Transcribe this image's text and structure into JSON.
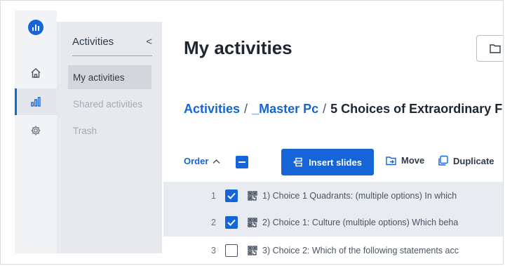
{
  "nav": {
    "section_title": "Activities",
    "collapse_glyph": "<",
    "items": [
      {
        "label": "My activities",
        "active": true
      },
      {
        "label": "Shared activities",
        "active": false
      },
      {
        "label": "Trash",
        "active": false
      }
    ]
  },
  "rail": {
    "icons": [
      "logo-icon",
      "home-icon",
      "activities-chart-icon",
      "settings-gear-icon"
    ]
  },
  "header": {
    "title": "My activities"
  },
  "breadcrumb": {
    "root": "Activities",
    "sep1": "/",
    "folder": "_Master Pc",
    "sep2": "/",
    "current": "5 Choices of Extraordinary F"
  },
  "toolbar": {
    "order_label": "Order",
    "insert_label": "Insert slides",
    "move_label": "Move",
    "duplicate_label": "Duplicate"
  },
  "rows": [
    {
      "num": "1",
      "checked": true,
      "text": "1) Choice 1 Quadrants: (multiple options) In which"
    },
    {
      "num": "2",
      "checked": true,
      "text": "2) Choice 1: Culture (multiple options) Which beha"
    },
    {
      "num": "3",
      "checked": false,
      "text": "3) Choice 2: Which of the following statements acc"
    }
  ],
  "colors": {
    "accent": "#1565d8",
    "selected_row": "#e8ebef",
    "subnav_bg": "#e7e9ec"
  }
}
